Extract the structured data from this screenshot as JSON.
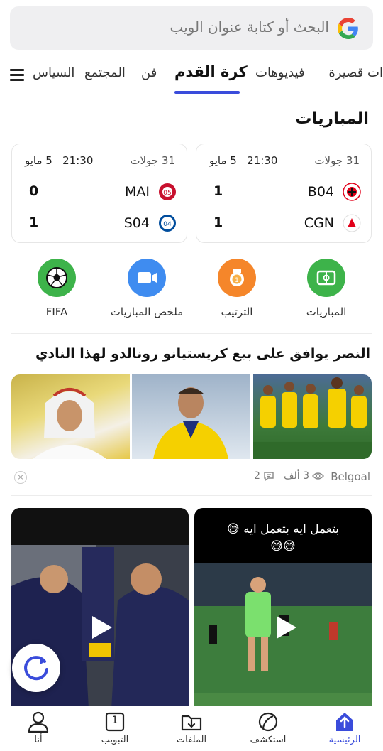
{
  "search": {
    "placeholder": "البحث أو كتابة عنوان الويب",
    "icon": "google-icon"
  },
  "tabs": {
    "items": [
      {
        "label": "ات قصيرة"
      },
      {
        "label": "فيديوهات"
      },
      {
        "label": "كرة القدم",
        "active": true
      },
      {
        "label": "فن"
      },
      {
        "label": "المجتمع"
      },
      {
        "label": "السياس"
      }
    ],
    "menu_icon": "hamburger-menu-icon",
    "accent": "#3a4cdb"
  },
  "matches": {
    "title": "المباريات",
    "cards": [
      {
        "rounds": "31 جولات",
        "date": "5 مايو",
        "time": "21:30",
        "teams": [
          {
            "code": "B04",
            "score": "1"
          },
          {
            "code": "CGN",
            "score": "1"
          }
        ]
      },
      {
        "rounds": "31 جولات",
        "date": "5 مايو",
        "time": "21:30",
        "teams": [
          {
            "code": "MAI",
            "score": "0"
          },
          {
            "code": "S04",
            "score": "1"
          }
        ]
      }
    ]
  },
  "quick_links": [
    {
      "label": "المباريات",
      "color": "#3db34a",
      "icon": "stadium-icon"
    },
    {
      "label": "الترتيب",
      "color": "#f5862a",
      "icon": "medal-icon"
    },
    {
      "label": "ملخص المباريات",
      "color": "#3f8cf0",
      "icon": "video-camera-icon"
    },
    {
      "label": "FIFA",
      "color": "#3db34a",
      "icon": "football-icon"
    }
  ],
  "news": {
    "title": "النصر يوافق على بيع كريستيانو رونالدو لهذا النادي",
    "source": "Belgoal",
    "views": "3 ألف",
    "comments": "2",
    "dismiss": "×"
  },
  "videos": [
    {
      "caption": "بتعمل ايه بتعمل ايه 😅\n😅😅"
    },
    {
      "caption": ""
    }
  ],
  "bottom_nav": [
    {
      "label": "الرئيسية",
      "icon": "home-icon",
      "active": true
    },
    {
      "label": "استكشف",
      "icon": "explore-icon"
    },
    {
      "label": "الملفات",
      "icon": "download-folder-icon"
    },
    {
      "label": "التبويب",
      "icon": "tabs-icon",
      "count": "1"
    },
    {
      "label": "أنا",
      "icon": "profile-icon"
    }
  ]
}
